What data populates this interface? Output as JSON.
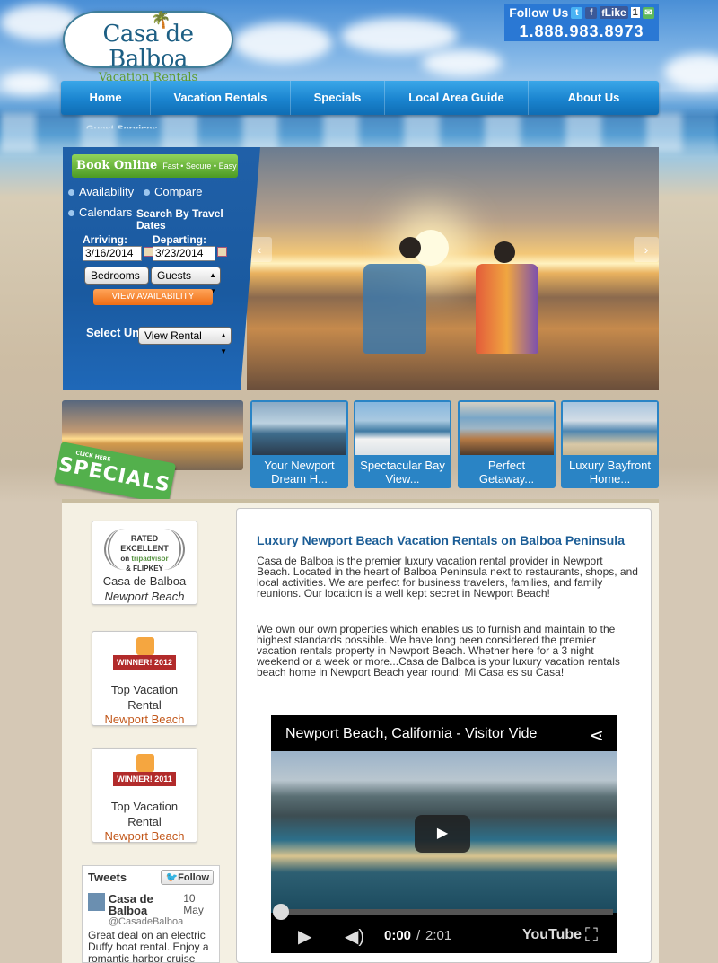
{
  "header": {
    "logo_name": "Casa de Balboa",
    "logo_sub": "Vacation Rentals",
    "follow_label": "Follow Us",
    "like_label": "Like",
    "like_count": "1",
    "phone": "1.888.983.8973"
  },
  "nav": {
    "items": [
      "Home",
      "Vacation Rentals",
      "Specials",
      "Local Area Guide",
      "About Us"
    ],
    "sub_partial": "Guest Services"
  },
  "booking": {
    "book_online": "Book Online",
    "book_tagline": "Fast • Secure • Easy",
    "links": [
      "Availability",
      "Compare",
      "Calendars"
    ],
    "search_heading": "Search By Travel Dates",
    "arriving_label": "Arriving:",
    "departing_label": "Departing:",
    "arriving_value": "3/16/2014",
    "departing_value": "3/23/2014",
    "bedrooms": "Bedrooms",
    "guests": "Guests",
    "view_availability": "VIEW AVAILABILITY",
    "select_unit_label": "Select Unit",
    "view_rental": "View Rental"
  },
  "specials": {
    "tag": "SPECIALS",
    "tag_small": "CLICK HERE"
  },
  "thumbs": [
    "Your Newport Dream H...",
    "Spectacular Bay View...",
    "Perfect Getaway...",
    "Luxury Bayfront Home..."
  ],
  "sidebar": {
    "ta_rated": "RATED EXCELLENT",
    "ta_on": "on",
    "ta_brand": "tripadvisor",
    "ta_and": "& FLIPKEY",
    "ta_name": "Casa de Balboa",
    "ta_place": "Newport Beach",
    "award1_ribbon": "WINNER! 2012",
    "award1_title": "Top Vacation Rental",
    "award1_place": "Newport Beach",
    "award2_ribbon": "WINNER! 2011",
    "award2_title": "Top Vacation Rental",
    "award2_place": "Newport Beach"
  },
  "tweets": {
    "title": "Tweets",
    "follow": "Follow",
    "author": "Casa de Balboa",
    "handle": "@CasadeBalboa",
    "date": "10 May",
    "text": "Great deal on an electric Duffy boat rental.  Enjoy a romantic harbor cruise"
  },
  "main": {
    "title": "Luxury Newport Beach Vacation Rentals on Balboa Peninsula",
    "para1": "Casa de Balboa is the premier luxury vacation rental provider in Newport Beach.  Located in the heart of Balboa Peninsula next to restaurants, shops, and local activities.  We are perfect for business travelers, families, and family reunions. Our location is a well kept secret in Newport Beach!",
    "para2": "We own our own properties which enables us to furnish and maintain to the highest standards possible. We have long been considered the premier vacation rentals property in Newport Beach.  Whether here for a 3 night weekend or a week or more...Casa de Balboa is your luxury vacation rentals beach home in Newport Beach year round!  Mi Casa es su Casa!"
  },
  "video": {
    "title": "Newport Beach, California - Visitor Vide",
    "time_current": "0:00",
    "time_total": "2:01",
    "brand": "YouTube",
    "progress": 0
  },
  "colors": {
    "nav_blue": "#1a84cf",
    "accent_orange": "#c2571a",
    "title_blue": "#1b5d96",
    "green": "#53b04c"
  }
}
